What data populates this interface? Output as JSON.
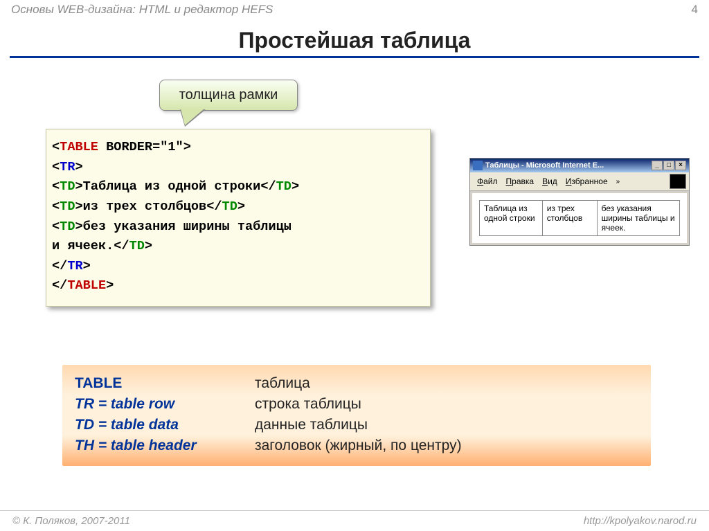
{
  "header": {
    "title": "Основы WEB-дизайна: HTML и редактор HEFS",
    "page_number": "4"
  },
  "title": "Простейшая таблица",
  "callout": "толщина рамки",
  "code": {
    "l1_pre": "<",
    "l1_tag": "TABLE",
    "l1_attr": " BORDER=\"1\"",
    "l1_post": ">",
    "l2_pre": "<",
    "l2_tag": "TR",
    "l2_post": ">",
    "l3_pre": "   <",
    "l3_tag": "TD",
    "l3_post": ">",
    "l3_text": "Таблица из одной строки",
    "l3_close_pre": "</",
    "l3_close_post": ">",
    "l4_pre": "   <",
    "l4_tag": "TD",
    "l4_post": ">",
    "l4_text": "из трех столбцов",
    "l4_close_pre": "</",
    "l4_close_post": ">",
    "l5_pre": "   <",
    "l5_tag": "TD",
    "l5_post": ">",
    "l5_text": "без указания ширины таблицы",
    "l6_text": "        и ячеек.",
    "l6_close_pre": "</",
    "l6_close_tag": "TD",
    "l6_close_post": ">",
    "l7_pre": "</",
    "l7_tag": "TR",
    "l7_post": ">",
    "l8_pre": "</",
    "l8_tag": "TABLE",
    "l8_post": ">"
  },
  "browser": {
    "title": "Таблицы - Microsoft Internet E...",
    "menu": {
      "file": "Файл",
      "edit": "Правка",
      "view": "Вид",
      "fav": "Избранное"
    },
    "cells": [
      "Таблица из одной строки",
      "из трех столбцов",
      "без указания ширины таблицы и ячеек."
    ]
  },
  "legend": {
    "rows": [
      {
        "term": "TABLE",
        "italic": false,
        "desc": "таблица"
      },
      {
        "term": "TR = table row",
        "italic": true,
        "desc": "строка таблицы"
      },
      {
        "term": "TD = table data",
        "italic": true,
        "desc": "данные таблицы"
      },
      {
        "term": "TH = table header",
        "italic": true,
        "desc": "заголовок (жирный, по центру)"
      }
    ]
  },
  "footer": {
    "copyright": "© К. Поляков, 2007-2011",
    "url": "http://kpolyakov.narod.ru"
  }
}
